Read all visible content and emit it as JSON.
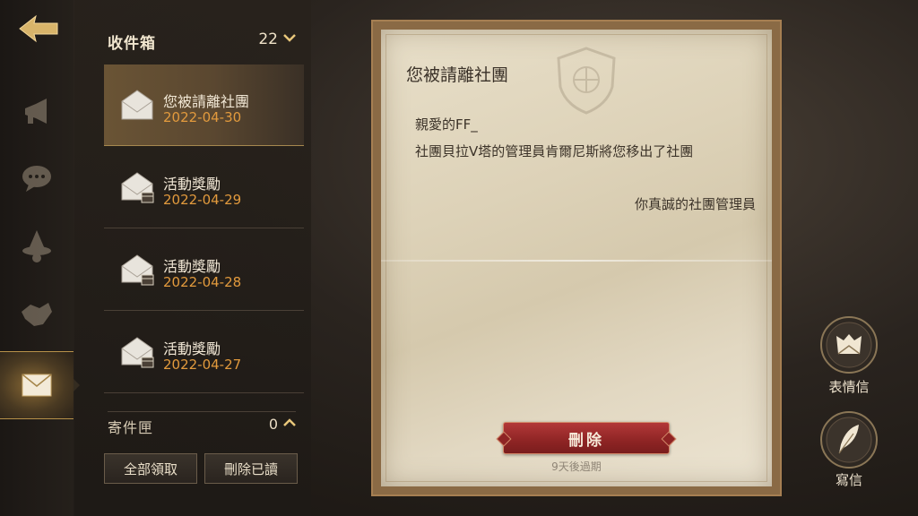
{
  "nav": {
    "back_icon": "back-arrow-icon",
    "rail_icons": [
      "megaphone-icon",
      "chat-bubble-icon",
      "wizard-hat-icon",
      "handshake-icon",
      "envelope-icon"
    ],
    "active": "envelope-icon"
  },
  "inbox": {
    "title": "收件箱",
    "count": "22",
    "items": [
      {
        "title": "您被請離社團",
        "date": "2022-04-30",
        "icon": "open-letter-icon",
        "active": true
      },
      {
        "title": "活動獎勵",
        "date": "2022-04-29",
        "icon": "letter-with-chest-icon",
        "active": false
      },
      {
        "title": "活動獎勵",
        "date": "2022-04-28",
        "icon": "letter-with-chest-icon",
        "active": false
      },
      {
        "title": "活動獎勵",
        "date": "2022-04-27",
        "icon": "letter-with-chest-icon",
        "active": false
      }
    ]
  },
  "outbox": {
    "title": "寄件匣",
    "count": "0"
  },
  "actions": {
    "claim_all": "全部領取",
    "delete_read": "刪除已讀"
  },
  "letter": {
    "title": "您被請離社團",
    "greeting": "親愛的FF_",
    "body": "社團貝拉V塔的管理員肯爾尼斯將您移出了社團",
    "signature": "你真誠的社團管理員",
    "delete_label": "刪除",
    "expiry": "9天後過期"
  },
  "side_buttons": {
    "emoji_letter": "表情信",
    "write_letter": "寫信"
  },
  "colors": {
    "accent_gold": "#d4b06a",
    "date_orange": "#e29a3d",
    "delete_red": "#9e2a2a"
  }
}
